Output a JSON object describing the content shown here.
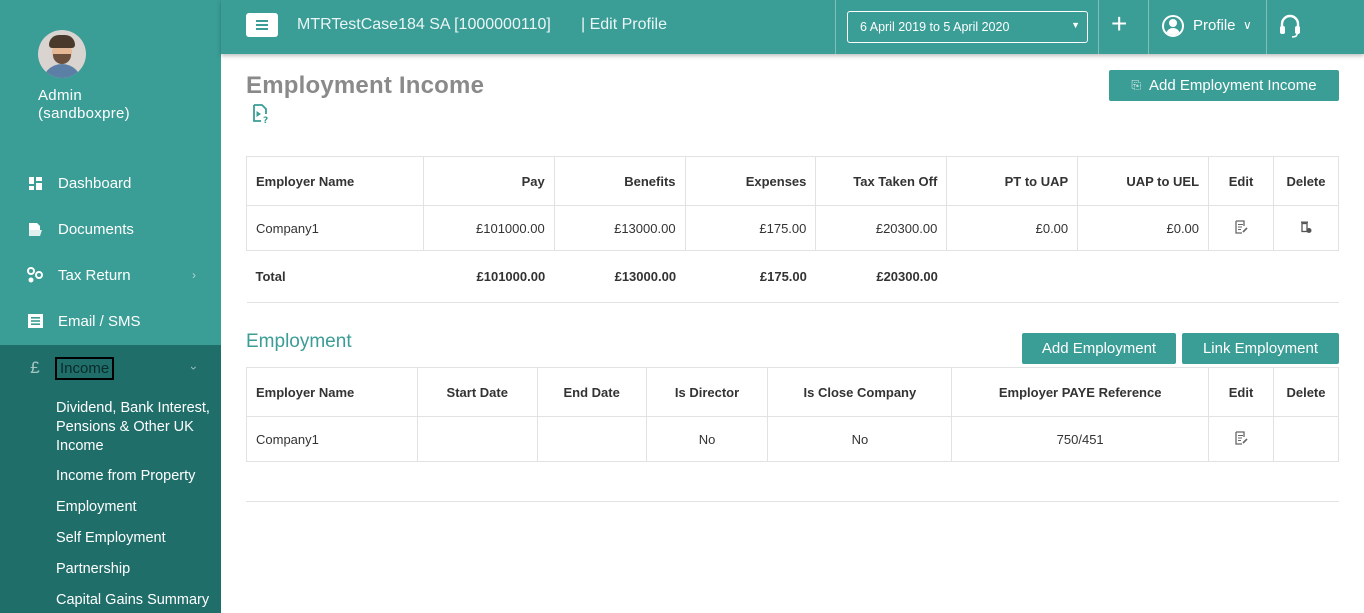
{
  "user": {
    "name": "Admin\n(sandboxpre)"
  },
  "sidebar": {
    "items": [
      {
        "label": "Dashboard",
        "icon": "dashboard-icon"
      },
      {
        "label": "Documents",
        "icon": "documents-icon"
      },
      {
        "label": "Tax Return",
        "icon": "tax-return-icon"
      },
      {
        "label": "Email / SMS",
        "icon": "email-sms-icon"
      },
      {
        "label": "Income",
        "icon": "pound-icon"
      }
    ],
    "income_sub": [
      "Dividend, Bank Interest, Pensions & Other UK Income",
      "Income from Property",
      "Employment",
      "Self Employment",
      "Partnership",
      "Capital Gains Summary"
    ],
    "currency_symbol": "£"
  },
  "header": {
    "client": "MTRTestCase184 SA [1000000110]",
    "edit_profile": "| Edit Profile",
    "period": "6 April 2019 to 5 April 2020",
    "profile_label": "Profile"
  },
  "main": {
    "title": "Employment Income",
    "add_employment_income": "Add Employment Income",
    "income_table": {
      "headers": [
        "Employer Name",
        "Pay",
        "Benefits",
        "Expenses",
        "Tax Taken Off",
        "PT to UAP",
        "UAP to UEL",
        "Edit",
        "Delete"
      ],
      "row": [
        "Company1",
        "£101000.00",
        "£13000.00",
        "£175.00",
        "£20300.00",
        "£0.00",
        "£0.00"
      ],
      "total": [
        "Total",
        "£101000.00",
        "£13000.00",
        "£175.00",
        "£20300.00"
      ]
    },
    "employment_section": {
      "title": "Employment",
      "add_label": "Add Employment",
      "link_label": "Link Employment",
      "headers": [
        "Employer Name",
        "Start Date",
        "End Date",
        "Is Director",
        "Is Close Company",
        "Employer PAYE Reference",
        "Edit",
        "Delete"
      ],
      "row": [
        "Company1",
        "",
        "",
        "No",
        "No",
        "750/451"
      ]
    }
  },
  "colors": {
    "primary": "#3a9d96",
    "sidebar_active": "#1f6e6a",
    "title_grey": "#8a8a8a"
  }
}
